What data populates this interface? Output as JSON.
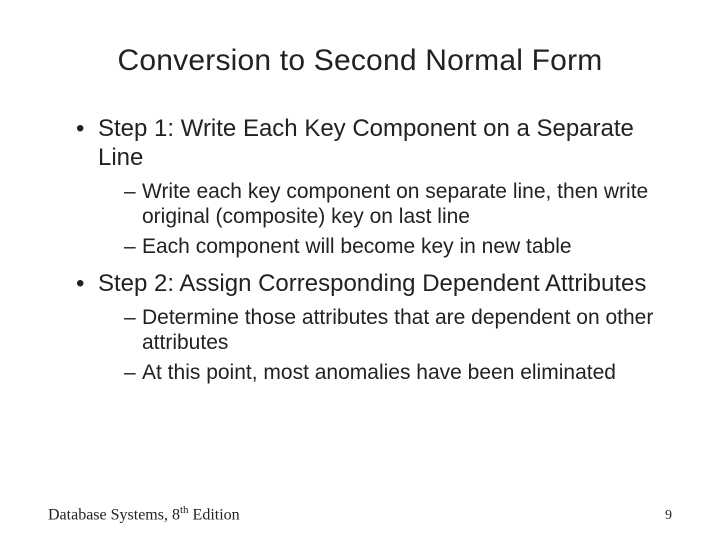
{
  "title": "Conversion to Second Normal Form",
  "bullets": [
    {
      "text": "Step 1: Write Each Key Component on a Separate Line",
      "sub": [
        "Write each key component on separate line, then write original (composite) key on last line",
        "Each component will become key in new table"
      ]
    },
    {
      "text": "Step 2: Assign Corresponding Dependent Attributes",
      "sub": [
        "Determine those attributes that are dependent on other attributes",
        "At this point, most anomalies have been eliminated"
      ]
    }
  ],
  "footer": {
    "source_prefix": "Database Systems, 8",
    "source_sup": "th",
    "source_suffix": " Edition",
    "page": "9"
  }
}
